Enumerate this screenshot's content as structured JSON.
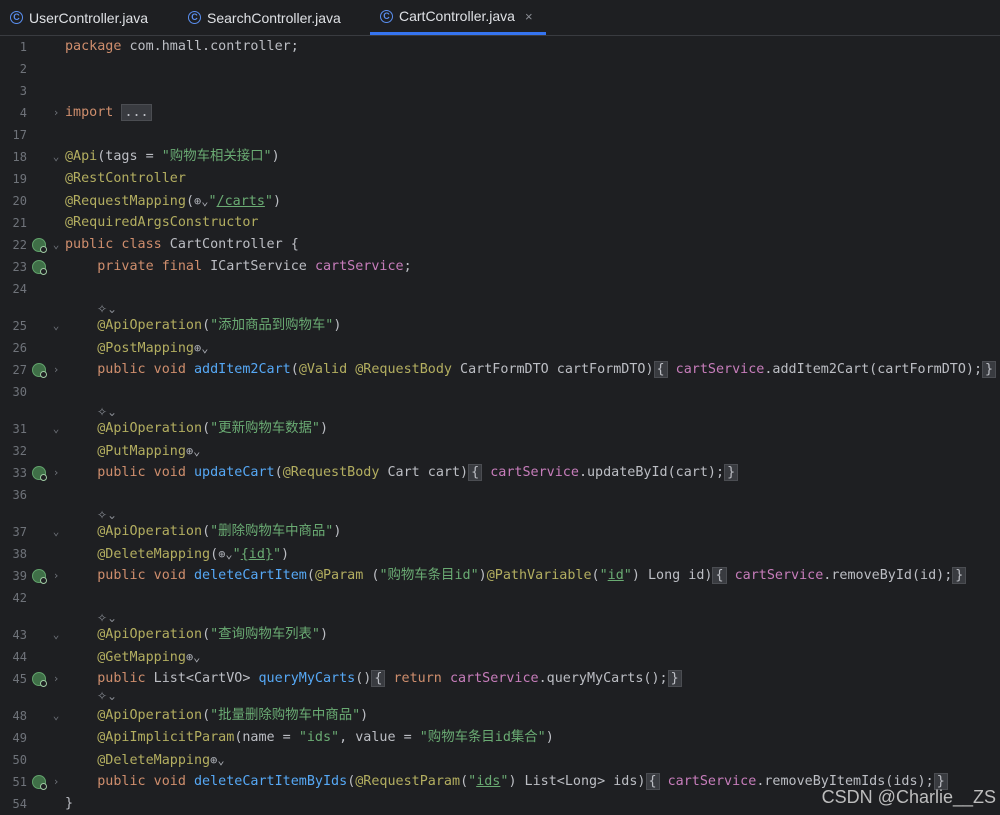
{
  "tabs": [
    {
      "label": "UserController.java",
      "active": false
    },
    {
      "label": "SearchController.java",
      "active": false
    },
    {
      "label": "CartController.java",
      "active": true,
      "close": "×"
    }
  ],
  "icons": {
    "class_icon": "c-class-icon",
    "implements": "implementation-gutter-icon",
    "fold_closed": "›",
    "fold_open": "⌄",
    "globe": "globe-icon",
    "ai_hint": "ai-hint-icon"
  },
  "colors": {
    "background": "#1e1f22",
    "keyword": "#cf8e6d",
    "annotation": "#b3ae60",
    "string": "#6aab73",
    "method": "#56a8f5",
    "field": "#c77dbb",
    "accent": "#3574f0"
  },
  "lines": [
    {
      "n": "1",
      "text": "package com.hmall.controller;"
    },
    {
      "n": "2",
      "text": ""
    },
    {
      "n": "3",
      "text": ""
    },
    {
      "n": "4",
      "text": "import ..."
    },
    {
      "n": "17",
      "text": ""
    },
    {
      "n": "18",
      "text": "@Api(tags = \"购物车相关接口\")"
    },
    {
      "n": "19",
      "text": "@RestController"
    },
    {
      "n": "20",
      "text": "@RequestMapping(\"/carts\")"
    },
    {
      "n": "21",
      "text": "@RequiredArgsConstructor"
    },
    {
      "n": "22",
      "text": "public class CartController {"
    },
    {
      "n": "23",
      "text": "    private final ICartService cartService;"
    },
    {
      "n": "24",
      "text": ""
    },
    {
      "n": "25",
      "text": "    @ApiOperation(\"添加商品到购物车\")"
    },
    {
      "n": "26",
      "text": "    @PostMapping"
    },
    {
      "n": "27",
      "text": "    public void addItem2Cart(@Valid @RequestBody CartFormDTO cartFormDTO) { cartService.addItem2Cart(cartFormDTO); }"
    },
    {
      "n": "30",
      "text": ""
    },
    {
      "n": "31",
      "text": "    @ApiOperation(\"更新购物车数据\")"
    },
    {
      "n": "32",
      "text": "    @PutMapping"
    },
    {
      "n": "33",
      "text": "    public void updateCart(@RequestBody Cart cart) { cartService.updateById(cart); }"
    },
    {
      "n": "36",
      "text": ""
    },
    {
      "n": "37",
      "text": "    @ApiOperation(\"删除购物车中商品\")"
    },
    {
      "n": "38",
      "text": "    @DeleteMapping(\"{id}\")"
    },
    {
      "n": "39",
      "text": "    public void deleteCartItem(@Param (\"购物车条目id\")@PathVariable(\"id\") Long id) { cartService.removeById(id); }"
    },
    {
      "n": "42",
      "text": ""
    },
    {
      "n": "43",
      "text": "    @ApiOperation(\"查询购物车列表\")"
    },
    {
      "n": "44",
      "text": "    @GetMapping"
    },
    {
      "n": "45",
      "text": "    public List<CartVO> queryMyCarts() { return cartService.queryMyCarts(); }"
    },
    {
      "n": "48",
      "text": "    @ApiOperation(\"批量删除购物车中商品\")"
    },
    {
      "n": "49",
      "text": "    @ApiImplicitParam(name = \"ids\", value = \"购物车条目id集合\")"
    },
    {
      "n": "50",
      "text": "    @DeleteMapping"
    },
    {
      "n": "51",
      "text": "    public void deleteCartItemByIds(@RequestParam(\"ids\") List<Long> ids) { cartService.removeByItemIds(ids); }"
    },
    {
      "n": "54",
      "text": "}"
    }
  ],
  "watermark": "CSDN @Charlie__ZS"
}
